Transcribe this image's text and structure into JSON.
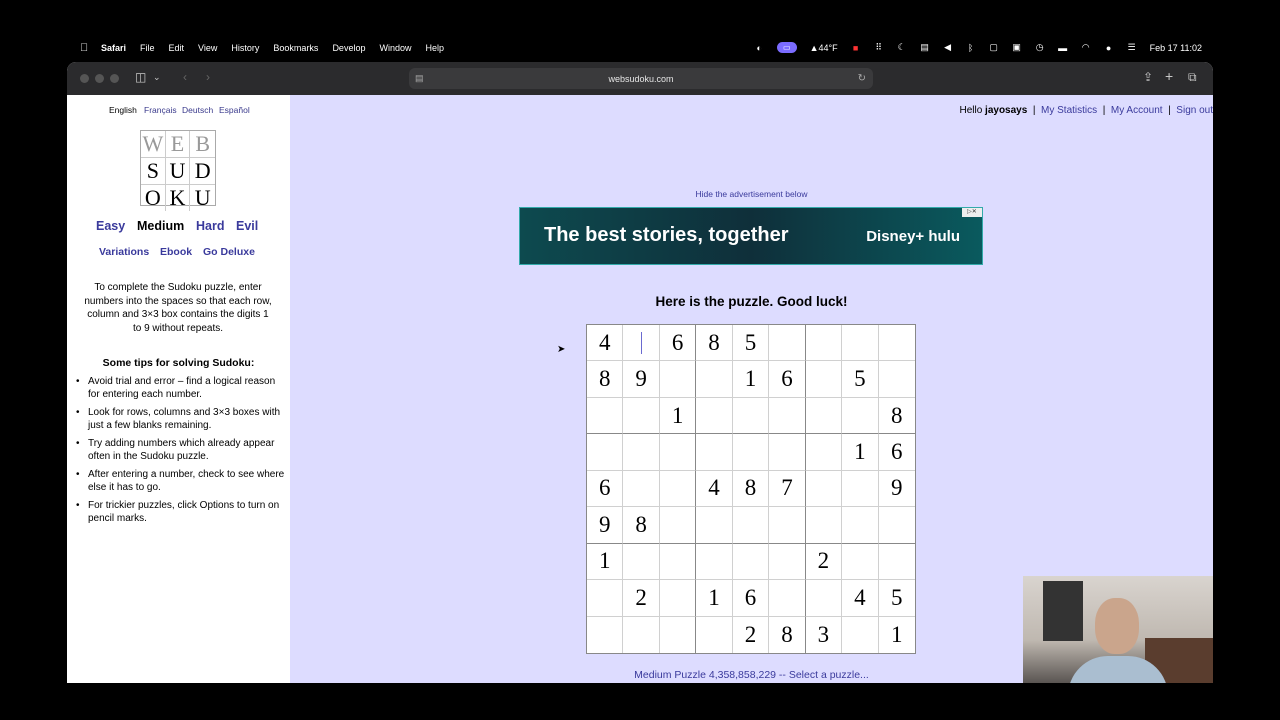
{
  "menubar": {
    "app_name": "Safari",
    "menus": [
      "File",
      "Edit",
      "View",
      "History",
      "Bookmarks",
      "Develop",
      "Window",
      "Help"
    ],
    "weather": "▲44°F",
    "datetime": "Feb 17  11:02"
  },
  "browser": {
    "url": "websudoku.com"
  },
  "sidebar": {
    "languages": [
      "English",
      "Français",
      "Deutsch",
      "Español"
    ],
    "logo_letters": [
      "W",
      "E",
      "B",
      "S",
      "U",
      "D",
      "O",
      "K",
      "U"
    ],
    "difficulties": [
      "Easy",
      "Medium",
      "Hard",
      "Evil"
    ],
    "links": [
      "Variations",
      "Ebook",
      "Go Deluxe"
    ],
    "intro": "To complete the Sudoku puzzle, enter numbers into the spaces so that each row, column and 3×3 box contains the digits 1 to 9 without repeats.",
    "tips_title": "Some tips for solving Sudoku:",
    "tips": [
      "Avoid trial and error – find a logical reason for entering each number.",
      "Look for rows, columns and 3×3 boxes with just a few blanks remaining.",
      "Try adding numbers which already appear often in the Sudoku puzzle.",
      "After entering a number, check to see where else it has to go.",
      "For trickier puzzles, click Options to turn on pencil marks."
    ]
  },
  "userbar": {
    "hello": "Hello",
    "username": "jayosays",
    "stats": "My Statistics",
    "account": "My Account",
    "signout": "Sign out"
  },
  "ad": {
    "hide_text": "Hide the advertisement below",
    "headline": "The best stories, together",
    "brand": "Disney+ hulu"
  },
  "puzzle": {
    "title": "Here is the puzzle. Good luck!",
    "grid": [
      [
        "4",
        "",
        "6",
        "8",
        "5",
        "",
        "",
        "",
        ""
      ],
      [
        "8",
        "9",
        "",
        "",
        "1",
        "6",
        "",
        "5",
        ""
      ],
      [
        "",
        "",
        "1",
        "",
        "",
        "",
        "",
        "",
        "8"
      ],
      [
        "",
        "",
        "",
        "",
        "",
        "",
        "",
        "1",
        "6"
      ],
      [
        "6",
        "",
        "",
        "4",
        "8",
        "7",
        "",
        "",
        "9"
      ],
      [
        "9",
        "8",
        "",
        "",
        "",
        "",
        "",
        "",
        ""
      ],
      [
        "1",
        "",
        "",
        "",
        "",
        "",
        "2",
        "",
        ""
      ],
      [
        "",
        "2",
        "",
        "1",
        "6",
        "",
        "",
        "4",
        "5"
      ],
      [
        "",
        "",
        "",
        "",
        "2",
        "8",
        "3",
        "",
        "1"
      ]
    ],
    "footer": "Medium Puzzle 4,358,858,229 -- Select a puzzle..."
  }
}
